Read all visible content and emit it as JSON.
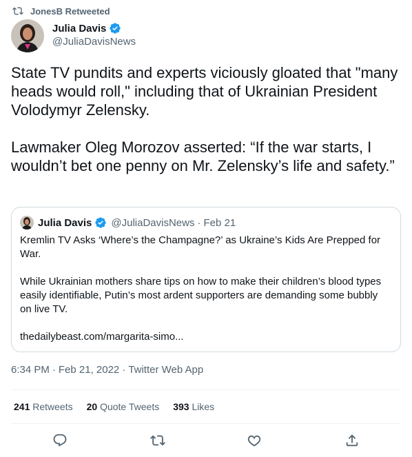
{
  "retweet": {
    "label": "JonesB Retweeted",
    "icon": "retweet-icon"
  },
  "author": {
    "name": "Julia Davis",
    "handle": "@JuliaDavisNews",
    "verified": true
  },
  "tweet_text": "State TV pundits and experts viciously gloated that \"many heads would roll,\" including that of Ukrainian President Volodymyr Zelensky.\n\nLawmaker Oleg Morozov asserted: “If the war starts, I wouldn’t bet one penny on Mr. Zelensky’s life and safety.”",
  "quote": {
    "name": "Julia Davis",
    "handle": "@JuliaDavisNews",
    "separator": "·",
    "date": "Feb 21",
    "title": "Kremlin TV Asks ‘Where’s the Champagne?’ as Ukraine’s Kids Are Prepped for War.",
    "body": "While Ukrainian mothers share tips on how to make their children’s blood types easily identifiable, Putin’s most ardent supporters are demanding some bubbly on live TV.",
    "link": "thedailybeast.com/margarita-simo..."
  },
  "meta": {
    "time": "6:34 PM",
    "sep1": "·",
    "date": "Feb 21, 2022",
    "sep2": "·",
    "source": "Twitter Web App"
  },
  "stats": {
    "retweets_count": "241",
    "retweets_label": "Retweets",
    "quotes_count": "20",
    "quotes_label": "Quote Tweets",
    "likes_count": "393",
    "likes_label": "Likes"
  },
  "actions": [
    "reply-icon",
    "retweet-icon",
    "like-icon",
    "share-icon"
  ],
  "colors": {
    "text": "#0f1419",
    "secondary": "#536471",
    "verified": "#1d9bf0",
    "border": "#cfd9de"
  }
}
